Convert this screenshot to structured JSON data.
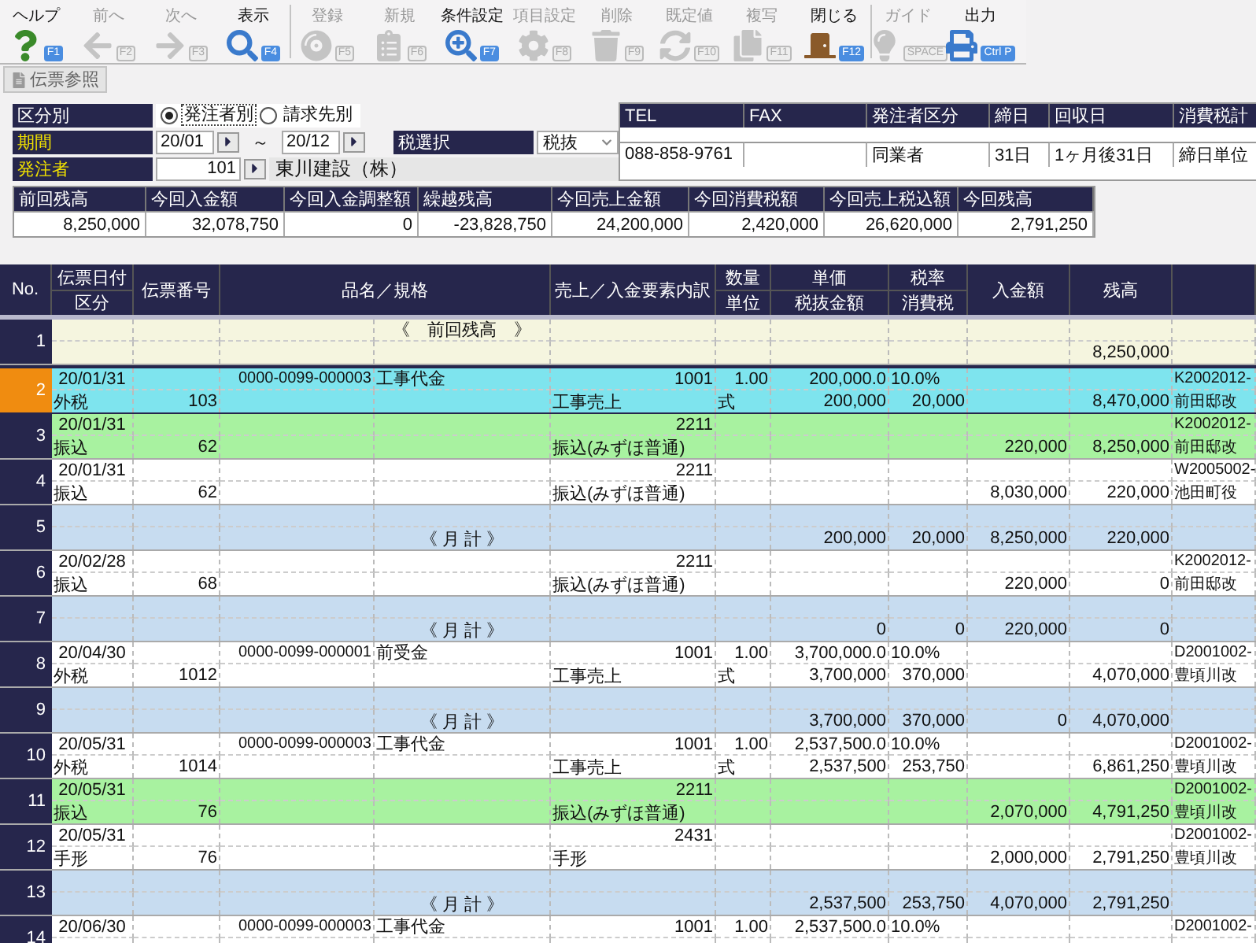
{
  "toolbar": {
    "groups": [
      [
        {
          "label": "ヘルプ",
          "key": "F1",
          "enabled": true
        },
        {
          "label": "前へ",
          "key": "F2",
          "enabled": false
        },
        {
          "label": "次へ",
          "key": "F3",
          "enabled": false
        },
        {
          "label": "表示",
          "key": "F4",
          "enabled": true
        }
      ],
      [
        {
          "label": "登録",
          "key": "F5",
          "enabled": false
        },
        {
          "label": "新規",
          "key": "F6",
          "enabled": false
        },
        {
          "label": "条件設定",
          "key": "F7",
          "enabled": true
        },
        {
          "label": "項目設定",
          "key": "F8",
          "enabled": false
        },
        {
          "label": "削除",
          "key": "F9",
          "enabled": false
        },
        {
          "label": "既定値",
          "key": "F10",
          "enabled": false
        },
        {
          "label": "複写",
          "key": "F11",
          "enabled": false
        },
        {
          "label": "閉じる",
          "key": "F12",
          "enabled": true
        }
      ],
      [
        {
          "label": "ガイド",
          "key": "SPACE",
          "enabled": false
        },
        {
          "label": "出力",
          "key": "Ctrl P",
          "enabled": true
        }
      ]
    ]
  },
  "tab": {
    "label": "伝票参照"
  },
  "form": {
    "group_by": {
      "label": "区分別",
      "required": false,
      "options": [
        {
          "label": "発注者別",
          "selected": true
        },
        {
          "label": "請求先別",
          "selected": false
        }
      ]
    },
    "period": {
      "label": "期間",
      "required": true,
      "from": "20/01",
      "separator": "～",
      "to": "20/12"
    },
    "tax_select": {
      "label": "税選択",
      "required": false,
      "value": "税抜"
    },
    "orderer": {
      "label": "発注者",
      "required": true,
      "code": "101",
      "name": "東川建設（株）"
    }
  },
  "info": [
    {
      "label": "TEL",
      "value": "088-858-9761"
    },
    {
      "label": "FAX"
    },
    {
      "label": "発注者区分",
      "value": "同業者"
    },
    {
      "label": "締日",
      "value": "31日"
    },
    {
      "label": "回収日",
      "value": "1ヶ月後31日"
    },
    {
      "label": "消費税計",
      "value": "締日単位"
    }
  ],
  "summary": {
    "columns": [
      "前回残高",
      "今回入金額",
      "今回入金調整額",
      "繰越残高",
      "今回売上金額",
      "今回消費税額",
      "今回売上税込額",
      "今回残高"
    ],
    "values": [
      "8,250,000",
      "32,078,750",
      "0",
      "-23,828,750",
      "24,200,000",
      "2,420,000",
      "26,620,000",
      "2,791,250"
    ]
  },
  "table": {
    "columns": [
      {
        "top": "No."
      },
      {
        "top": "伝票日付",
        "bottom": "区分"
      },
      {
        "top": "伝票番号"
      },
      {
        "top": "品名／規格"
      },
      {
        "top": "売上／入金要素内訳"
      },
      {
        "top": "数量",
        "bottom": "単位"
      },
      {
        "top": "単価",
        "bottom": "税抜金額"
      },
      {
        "top": "税率",
        "bottom": "消費税"
      },
      {
        "top": "入金額"
      },
      {
        "top": "残高"
      }
    ],
    "rows": [
      {
        "no": "1",
        "kind": "balance",
        "selected": false,
        "highlighted": false,
        "label": "《　前回残高　》",
        "balance": "8,250,000"
      },
      {
        "no": "2",
        "kind": "entry",
        "selected": true,
        "highlighted": false,
        "date": "20/01/31",
        "code": "0000-0099-000003",
        "item": "工事代金",
        "element_code": "1001",
        "qty": "1.00",
        "unit_price": "200,000.0",
        "tax_rate": "10.0%",
        "column_12_top": "K2002012-",
        "category": "外税",
        "slip_no": "103",
        "element_name": "工事売上",
        "unit": "式",
        "excl_amount": "200,000",
        "tax": "20,000",
        "balance": "8,470,000",
        "column_12_bottom": "前田邸改"
      },
      {
        "no": "3",
        "kind": "entry",
        "selected": false,
        "highlighted": true,
        "date": "20/01/31",
        "element_code": "2211",
        "column_12_top": "K2002012-",
        "category": "振込",
        "slip_no": "62",
        "element_name": "振込(みずほ普通)",
        "payment": "220,000",
        "balance": "8,250,000",
        "column_12_bottom": "前田邸改"
      },
      {
        "no": "4",
        "kind": "entry",
        "selected": false,
        "highlighted": false,
        "date": "20/01/31",
        "element_code": "2211",
        "column_12_top": "W2005002-",
        "category": "振込",
        "slip_no": "62",
        "element_name": "振込(みずほ普通)",
        "payment": "8,030,000",
        "balance": "220,000",
        "column_12_bottom": "池田町役"
      },
      {
        "no": "5",
        "kind": "month_total",
        "selected": false,
        "highlighted": false,
        "label": "《 月 計 》",
        "excl_amount": "200,000",
        "tax": "20,000",
        "payment": "8,250,000",
        "balance": "220,000"
      },
      {
        "no": "6",
        "kind": "entry",
        "selected": false,
        "highlighted": false,
        "date": "20/02/28",
        "element_code": "2211",
        "column_12_top": "K2002012-",
        "category": "振込",
        "slip_no": "68",
        "element_name": "振込(みずほ普通)",
        "payment": "220,000",
        "balance": "0",
        "column_12_bottom": "前田邸改"
      },
      {
        "no": "7",
        "kind": "month_total",
        "selected": false,
        "highlighted": false,
        "label": "《 月 計 》",
        "excl_amount": "0",
        "tax": "0",
        "payment": "220,000",
        "balance": "0"
      },
      {
        "no": "8",
        "kind": "entry",
        "selected": false,
        "highlighted": false,
        "date": "20/04/30",
        "code": "0000-0099-000001",
        "item": "前受金",
        "element_code": "1001",
        "qty": "1.00",
        "unit_price": "3,700,000.0",
        "tax_rate": "10.0%",
        "column_12_top": "D2001002-",
        "category": "外税",
        "slip_no": "1012",
        "element_name": "工事売上",
        "unit": "式",
        "excl_amount": "3,700,000",
        "tax": "370,000",
        "balance": "4,070,000",
        "column_12_bottom": "豊頃川改"
      },
      {
        "no": "9",
        "kind": "month_total",
        "selected": false,
        "highlighted": false,
        "label": "《 月 計 》",
        "excl_amount": "3,700,000",
        "tax": "370,000",
        "payment": "0",
        "balance": "4,070,000"
      },
      {
        "no": "10",
        "kind": "entry",
        "selected": false,
        "highlighted": false,
        "date": "20/05/31",
        "code": "0000-0099-000003",
        "item": "工事代金",
        "element_code": "1001",
        "qty": "1.00",
        "unit_price": "2,537,500.0",
        "tax_rate": "10.0%",
        "column_12_top": "D2001002-",
        "category": "外税",
        "slip_no": "1014",
        "element_name": "工事売上",
        "unit": "式",
        "excl_amount": "2,537,500",
        "tax": "253,750",
        "balance": "6,861,250",
        "column_12_bottom": "豊頃川改"
      },
      {
        "no": "11",
        "kind": "entry",
        "selected": false,
        "highlighted": true,
        "date": "20/05/31",
        "element_code": "2211",
        "column_12_top": "D2001002-",
        "category": "振込",
        "slip_no": "76",
        "element_name": "振込(みずほ普通)",
        "payment": "2,070,000",
        "balance": "4,791,250",
        "column_12_bottom": "豊頃川改"
      },
      {
        "no": "12",
        "kind": "entry",
        "selected": false,
        "highlighted": false,
        "date": "20/05/31",
        "element_code": "2431",
        "column_12_top": "D2001002-",
        "category": "手形",
        "slip_no": "76",
        "element_name": "手形",
        "payment": "2,000,000",
        "balance": "2,791,250",
        "column_12_bottom": "豊頃川改"
      },
      {
        "no": "13",
        "kind": "month_total",
        "selected": false,
        "highlighted": false,
        "label": "《 月 計 》",
        "excl_amount": "2,537,500",
        "tax": "253,750",
        "payment": "4,070,000",
        "balance": "2,791,250"
      },
      {
        "no": "14",
        "kind": "entry",
        "selected": false,
        "highlighted": false,
        "date": "20/06/30",
        "code": "0000-0099-000003",
        "item": "工事代金",
        "element_code": "1001",
        "qty": "1.00",
        "unit_price": "2,537,500.0",
        "tax_rate": "10.0%",
        "column_12_top": "D2001002-"
      }
    ]
  }
}
